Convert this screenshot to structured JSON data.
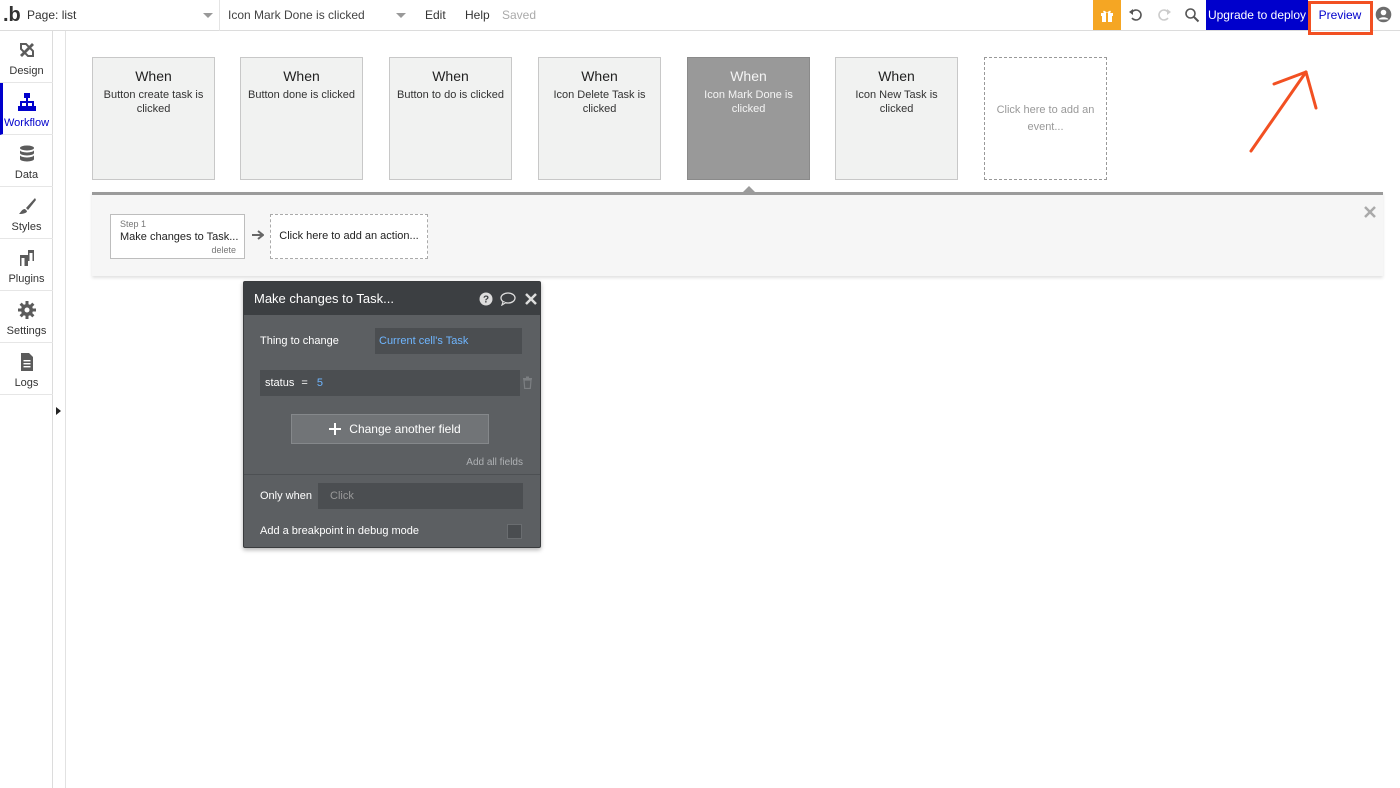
{
  "topbar": {
    "logo": ".b",
    "page_select": "Page: list",
    "event_select": "Icon Mark Done is clicked",
    "menu_edit": "Edit",
    "menu_help": "Help",
    "save_status": "Saved",
    "upgrade_label": "Upgrade to deploy",
    "preview_label": "Preview",
    "accent_color": "#0000cc",
    "gift_color": "#f5a623",
    "highlight_color": "#f25022"
  },
  "sidebar": {
    "items": [
      {
        "label": "Design",
        "icon": "design-icon"
      },
      {
        "label": "Workflow",
        "icon": "workflow-icon"
      },
      {
        "label": "Data",
        "icon": "database-icon"
      },
      {
        "label": "Styles",
        "icon": "brush-icon"
      },
      {
        "label": "Plugins",
        "icon": "plugin-icon"
      },
      {
        "label": "Settings",
        "icon": "gear-icon"
      },
      {
        "label": "Logs",
        "icon": "document-icon"
      }
    ]
  },
  "events": [
    {
      "when": "When",
      "desc": "Button create task is clicked"
    },
    {
      "when": "When",
      "desc": "Button done is clicked"
    },
    {
      "when": "When",
      "desc": "Button to do is clicked"
    },
    {
      "when": "When",
      "desc": "Icon Delete Task is clicked"
    },
    {
      "when": "When",
      "desc": "Icon Mark Done is clicked"
    },
    {
      "when": "When",
      "desc": "Icon New Task is clicked"
    }
  ],
  "add_event_label": "Click here to add an event...",
  "steps": {
    "step_number": "Step 1",
    "step_name": "Make changes to Task...",
    "delete_label": "delete",
    "add_action_label": "Click here to add an action..."
  },
  "popup": {
    "title": "Make changes to Task...",
    "thing_label": "Thing to change",
    "thing_value": "Current cell's Task",
    "field_name": "status",
    "field_op": "=",
    "field_value": "5",
    "change_button": "Change another field",
    "add_all": "Add all fields",
    "only_when_label": "Only when",
    "only_when_placeholder": "Click",
    "breakpoint_label": "Add a breakpoint in debug mode"
  }
}
